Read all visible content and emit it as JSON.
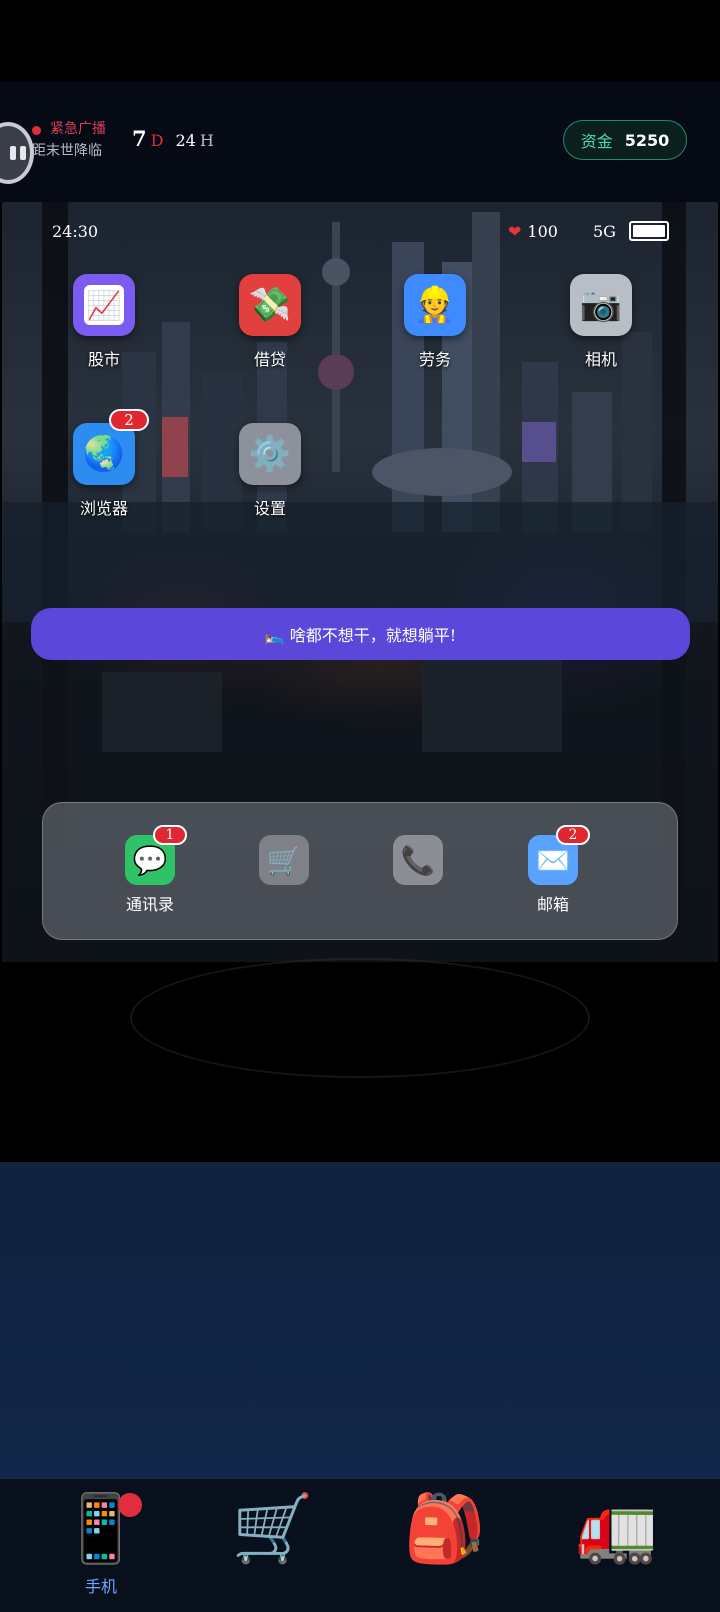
{
  "header": {
    "broadcast_title": "紧急广播",
    "broadcast_sub": "距末世降临",
    "countdown_days": "7",
    "countdown_days_unit": "D",
    "countdown_hours": "24",
    "countdown_hours_unit": "H",
    "funds_label": "资金",
    "funds_value": "5250"
  },
  "status": {
    "time": "24:30",
    "hp": "100",
    "signal": "5G"
  },
  "apps": [
    {
      "label": "股市",
      "icon": "chart-icon",
      "glyph": "📈",
      "color": "#7c5cf0"
    },
    {
      "label": "借贷",
      "icon": "money-wings-icon",
      "glyph": "💸",
      "color": "#e2403f"
    },
    {
      "label": "劳务",
      "icon": "worker-icon",
      "glyph": "👷",
      "color": "#3d8bff"
    },
    {
      "label": "相机",
      "icon": "camera-icon",
      "glyph": "📷",
      "color": "#b9bdc6"
    },
    {
      "label": "浏览器",
      "icon": "globe-icon",
      "glyph": "🌏",
      "color": "#2d8cf0",
      "badge": "2"
    },
    {
      "label": "设置",
      "icon": "gear-icon",
      "glyph": "⚙️",
      "color": "#8c919b"
    }
  ],
  "banner": {
    "icon": "bed-icon",
    "text": "🛌 啥都不想干，就想躺平!"
  },
  "dock": [
    {
      "label": "通讯录",
      "icon": "chat-icon",
      "glyph": "💬",
      "color": "#2fc266",
      "badge": "1"
    },
    {
      "label": "",
      "icon": "cart-icon",
      "glyph": "🛒",
      "color": "#7e8188"
    },
    {
      "label": "",
      "icon": "phone-icon",
      "glyph": "📞",
      "color": "#8b8e95"
    },
    {
      "label": "邮箱",
      "icon": "mail-icon",
      "glyph": "✉️",
      "color": "#5aa2ff",
      "badge": "2"
    }
  ],
  "bottom_nav": [
    {
      "label": "手机",
      "icon": "mobile-phone-icon",
      "glyph": "📱"
    },
    {
      "label": "",
      "icon": "shopping-cart-icon",
      "glyph": "🛒"
    },
    {
      "label": "",
      "icon": "backpack-icon",
      "glyph": "🎒"
    },
    {
      "label": "",
      "icon": "truck-icon",
      "glyph": "🚛"
    }
  ]
}
